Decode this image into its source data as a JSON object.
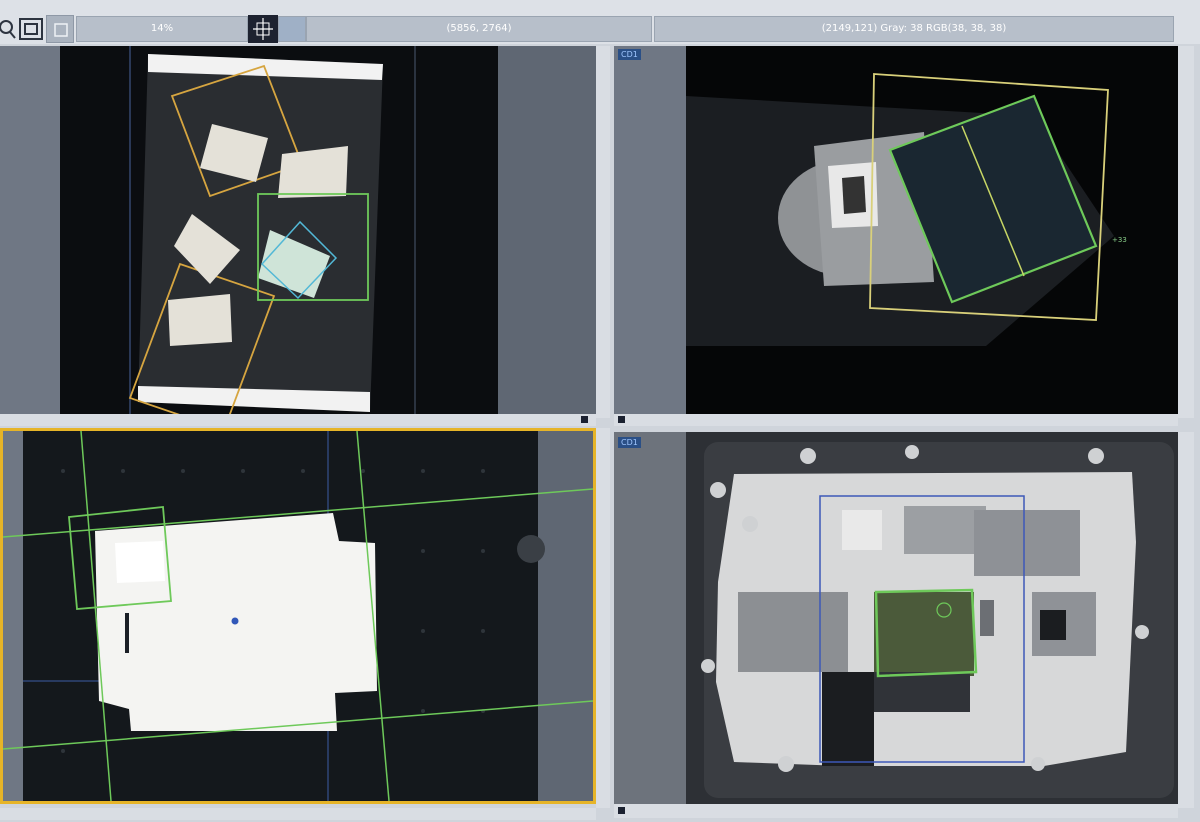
{
  "toolbar": {
    "zoom": "14%",
    "image_size": "(5856, 2764)",
    "pixel_info": "(2149,121) Gray: 38  RGB(38, 38, 38)"
  },
  "viewers": [
    {
      "id": "viewer-top-left",
      "tag": ""
    },
    {
      "id": "viewer-top-right",
      "tag": "CD1"
    },
    {
      "id": "viewer-bottom-left",
      "tag": ""
    },
    {
      "id": "viewer-bottom-right",
      "tag": "CD1"
    }
  ],
  "colors": {
    "match_green": "#6ec95a",
    "search_orange": "#d6a540",
    "roi_blue": "#3d58b8",
    "active_border": "#e6b428"
  },
  "icons": [
    "zoom-icon",
    "fit-window-icon",
    "grid-icon",
    "roi-tool-icon"
  ]
}
